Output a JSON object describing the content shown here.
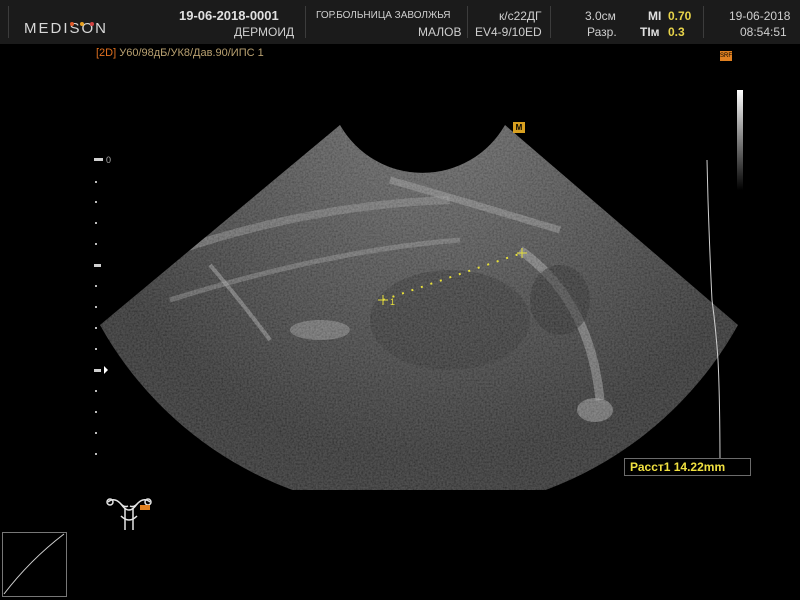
{
  "header": {
    "brand": "MEDISON",
    "brand_dot_colors": [
      "#e05a2a",
      "#e8a020",
      "#d04040"
    ],
    "patient_id": "19-06-2018-0001",
    "patient_name": "ДЕРМОИД",
    "hospital": "ГОР.БОЛЬНИЦА ЗАВОЛЖЬЯ",
    "operator": "МАЛОВ",
    "probe_setting": "к/с22ДГ",
    "probe": "EV4-9/10ED",
    "depth": "3.0см",
    "resolution_label": "Разр.",
    "mi_label": "MI",
    "mi_value": "0.70",
    "tim_label": "TIм",
    "tim_value": "0.3",
    "date": "19-06-2018",
    "time": "08:54:51"
  },
  "params": {
    "mode": "[2D]",
    "values": "У60/98дБ/УК8/Дав.90/ИПС 1"
  },
  "depth_scale": {
    "zero_label": "0"
  },
  "markers": {
    "srf_label": "SRF",
    "m_label": "M",
    "caliper_label": "1"
  },
  "measurement": {
    "text": "Расст1 14.22mm",
    "color": "#f0e040"
  },
  "accent_color": "#e8d44a"
}
